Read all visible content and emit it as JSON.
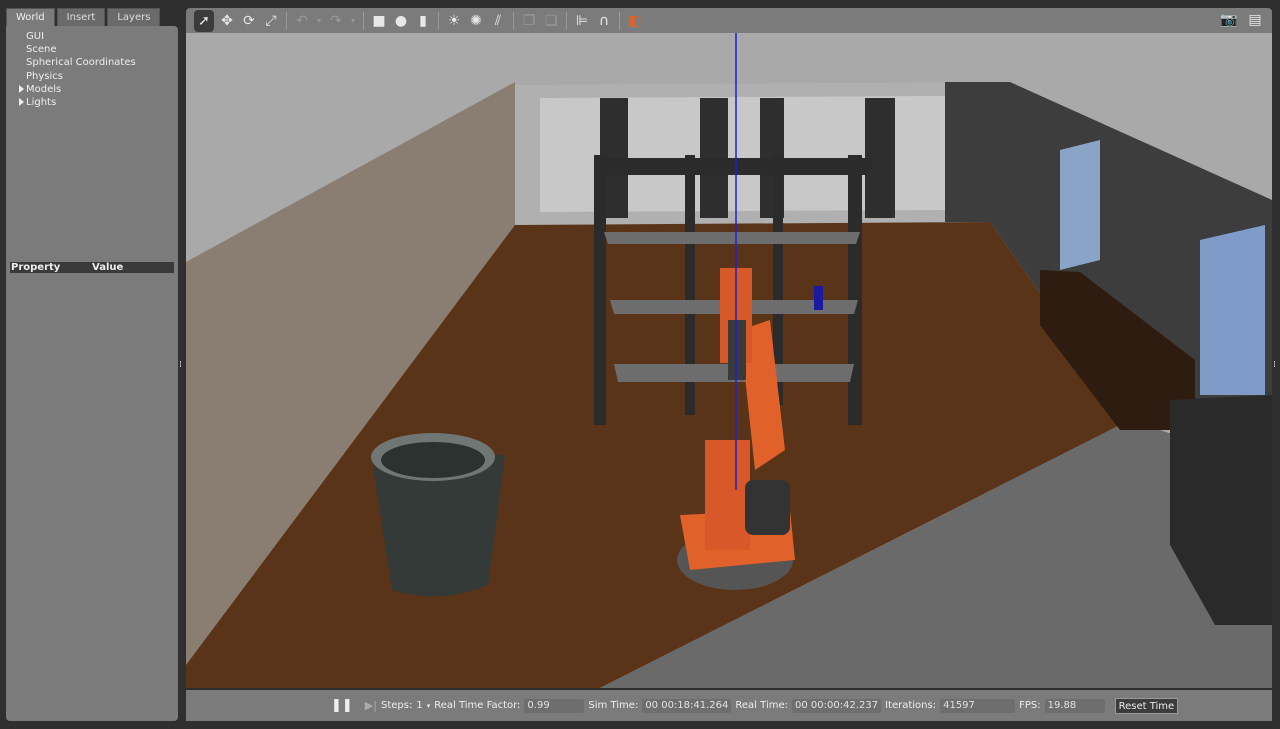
{
  "left_panel": {
    "tabs": [
      {
        "label": "World",
        "active": true
      },
      {
        "label": "Insert"
      },
      {
        "label": "Layers"
      }
    ],
    "tree": [
      {
        "label": "GUI",
        "expandable": false
      },
      {
        "label": "Scene",
        "expandable": false
      },
      {
        "label": "Spherical Coordinates",
        "expandable": false
      },
      {
        "label": "Physics",
        "expandable": false
      },
      {
        "label": "Models",
        "expandable": true
      },
      {
        "label": "Lights",
        "expandable": true
      }
    ],
    "property_header": {
      "property": "Property",
      "value": "Value"
    }
  },
  "toolbar": {
    "tools": [
      "select-arrow-icon",
      "translate-icon",
      "rotate-icon",
      "scale-icon",
      "undo-icon",
      "redo-icon",
      "box-icon",
      "sphere-icon",
      "cylinder-icon",
      "point-light-icon",
      "spot-light-icon",
      "directional-light-icon",
      "copy-icon",
      "paste-icon",
      "align-icon",
      "snap-icon",
      "view-angle-icon"
    ],
    "right": [
      "screenshot-icon",
      "log-icon"
    ]
  },
  "bottom_bar": {
    "steps_label": "Steps:",
    "steps_value": "1",
    "rtf_label": "Real Time Factor:",
    "rtf_value": "0.99",
    "sim_time_label": "Sim Time:",
    "sim_time_value": "00 00:18:41.264",
    "real_time_label": "Real Time:",
    "real_time_value": "00 00:00:42.237",
    "iterations_label": "Iterations:",
    "iterations_value": "41597",
    "fps_label": "FPS:",
    "fps_value": "19.88",
    "reset_label": "Reset Time"
  },
  "colors": {
    "panel": "#7b7b7b",
    "background": "#2f2f2f",
    "robot": "#e0622a",
    "floor": "#5a3418"
  }
}
